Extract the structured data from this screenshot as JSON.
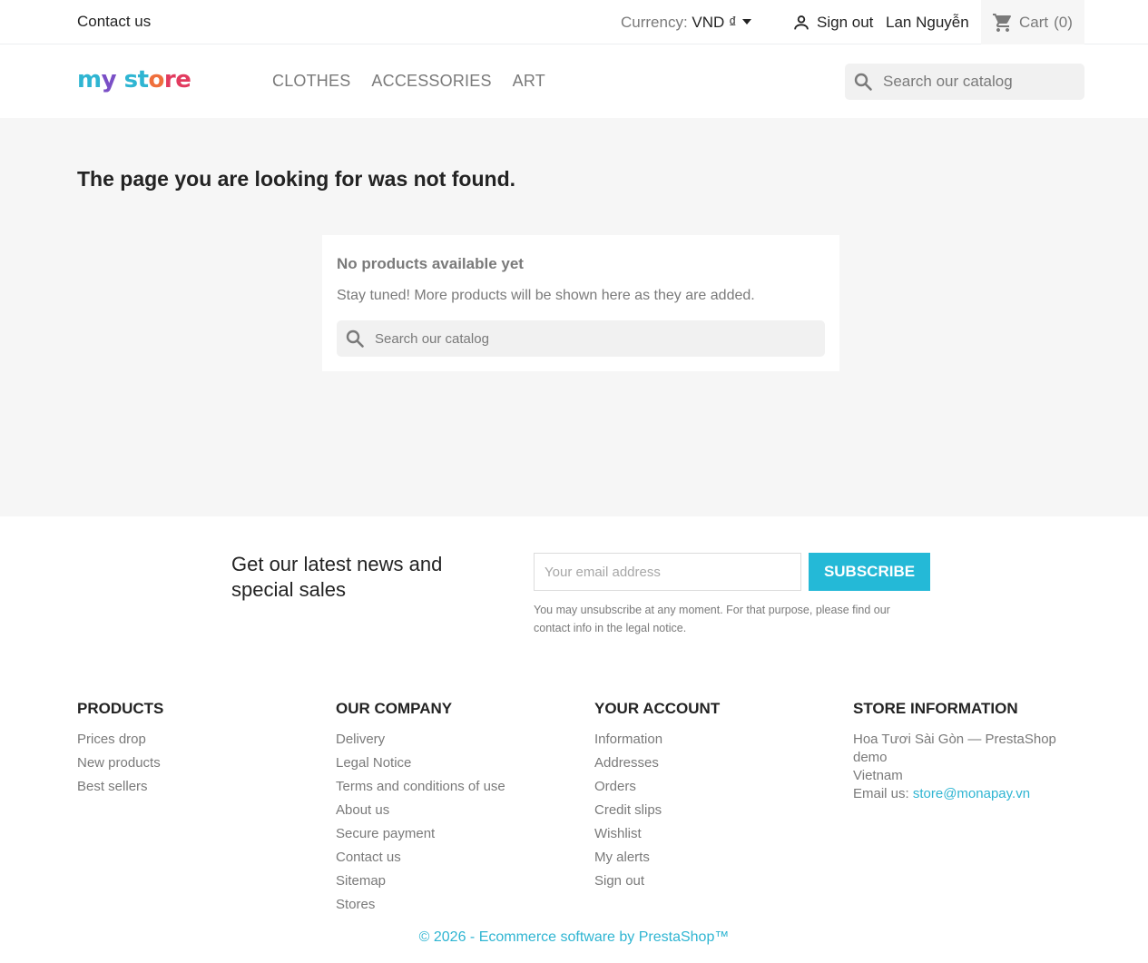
{
  "topbar": {
    "contact_label": "Contact us",
    "currency_label": "Currency:",
    "currency_value": "VND ₫",
    "signout_label": "Sign out",
    "user_name": "Lan Nguyễn",
    "cart_label": "Cart",
    "cart_count": "(0)"
  },
  "header": {
    "logo": {
      "p1": "m",
      "p2": "y",
      "p3": " st",
      "p4": "o",
      "p5": "re"
    },
    "nav": [
      "CLOTHES",
      "ACCESSORIES",
      "ART"
    ],
    "search_placeholder": "Search our catalog"
  },
  "main": {
    "title": "The page you are looking for was not found.",
    "card_title": "No products available yet",
    "card_text": "Stay tuned! More products will be shown here as they are added.",
    "search_placeholder": "Search our catalog"
  },
  "newsletter": {
    "title": "Get our latest news and special sales",
    "email_placeholder": "Your email address",
    "subscribe_label": "Subscribe",
    "note": "You may unsubscribe at any moment. For that purpose, please find our contact info in the legal notice."
  },
  "footer": {
    "products": {
      "title": "Products",
      "items": [
        "Prices drop",
        "New products",
        "Best sellers"
      ]
    },
    "company": {
      "title": "Our company",
      "items": [
        "Delivery",
        "Legal Notice",
        "Terms and conditions of use",
        "About us",
        "Secure payment",
        "Contact us",
        "Sitemap",
        "Stores"
      ]
    },
    "account": {
      "title": "Your account",
      "items": [
        "Information",
        "Addresses",
        "Orders",
        "Credit slips",
        "Wishlist",
        "My alerts",
        "Sign out"
      ]
    },
    "store": {
      "title": "Store information",
      "line1": "Hoa Tươi Sài Gòn — PrestaShop demo",
      "line2": "Vietnam",
      "email_label": "Email us:",
      "email": "store@monapay.vn"
    },
    "copyright": "© 2026 - Ecommerce software by PrestaShop™"
  },
  "colors": {
    "accent": "#24b9d7",
    "text": "#232323",
    "muted": "#7a7a7a"
  }
}
